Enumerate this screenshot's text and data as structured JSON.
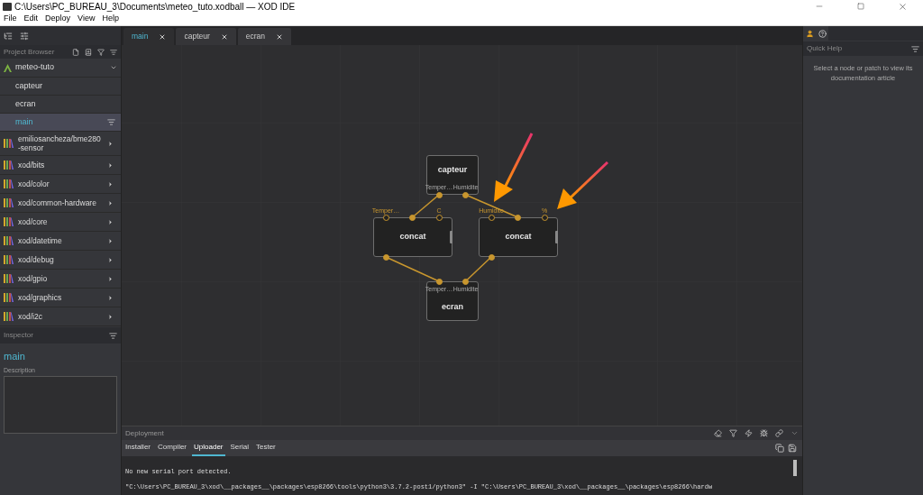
{
  "window": {
    "title": "C:\\Users\\PC_BUREAU_3\\Documents\\meteo_tuto.xodball — XOD IDE"
  },
  "menu": [
    "File",
    "Edit",
    "Deploy",
    "View",
    "Help"
  ],
  "project_browser": {
    "title": "Project Browser",
    "project": {
      "name": "meteo-tuto",
      "expanded": true,
      "patches": [
        {
          "label": "capteur",
          "selected": false
        },
        {
          "label": "ecran",
          "selected": false
        },
        {
          "label": "main",
          "selected": true
        }
      ]
    },
    "libraries": [
      {
        "label": "emiliosancheza/bme280-sensor",
        "expanded": false
      },
      {
        "label": "xod/bits",
        "expanded": false
      },
      {
        "label": "xod/color",
        "expanded": false
      },
      {
        "label": "xod/common-hardware",
        "expanded": false
      },
      {
        "label": "xod/core",
        "expanded": false
      },
      {
        "label": "xod/datetime",
        "expanded": false
      },
      {
        "label": "xod/debug",
        "expanded": false
      },
      {
        "label": "xod/gpio",
        "expanded": false
      },
      {
        "label": "xod/graphics",
        "expanded": false
      },
      {
        "label": "xod/i2c",
        "expanded": false
      }
    ]
  },
  "inspector": {
    "title": "Inspector",
    "patch_name": "main",
    "description_label": "Description"
  },
  "tabs": [
    {
      "label": "main",
      "selected": true
    },
    {
      "label": "capteur",
      "selected": false
    },
    {
      "label": "ecran",
      "selected": false
    }
  ],
  "nodes": [
    {
      "title": "capteur",
      "kind": "patch",
      "outputs": [
        {
          "label": "Temper…",
          "linked": true
        },
        {
          "label": "Humidite",
          "linked": true
        }
      ]
    },
    {
      "title": "concat",
      "kind": "variadic",
      "inputs": [
        {
          "label": "Temper…",
          "linked": false
        },
        {
          "linked": true
        },
        {
          "label": "C",
          "linked": false
        }
      ],
      "outputs": [
        {
          "linked": true
        }
      ]
    },
    {
      "title": "concat",
      "kind": "variadic",
      "inputs": [
        {
          "label": "Humidite",
          "linked": false
        },
        {
          "linked": true
        },
        {
          "label": "%",
          "linked": false
        }
      ],
      "outputs": [
        {
          "linked": true
        }
      ]
    },
    {
      "title": "ecran",
      "kind": "patch",
      "inputs": [
        {
          "label": "Temper…",
          "linked": true
        },
        {
          "label": "Humidite",
          "linked": true
        }
      ]
    }
  ],
  "quick_help": {
    "title": "Quick Help",
    "message": "Select a node or patch to view its documentation article"
  },
  "deployment": {
    "title": "Deployment",
    "tabs": [
      {
        "label": "Installer",
        "selected": false
      },
      {
        "label": "Compiler",
        "selected": false
      },
      {
        "label": "Uploader",
        "selected": true
      },
      {
        "label": "Serial",
        "selected": false
      },
      {
        "label": "Tester",
        "selected": false
      }
    ],
    "log": [
      "No new serial port detected.",
      "\"C:\\Users\\PC_BUREAU_3\\xod\\__packages__\\packages\\esp8266\\tools\\python3\\3.7.2-post1/python3\" -I \"C:\\Users\\PC_BUREAU_3\\xod\\__packages__\\packages\\esp8266\\hardw"
    ]
  }
}
